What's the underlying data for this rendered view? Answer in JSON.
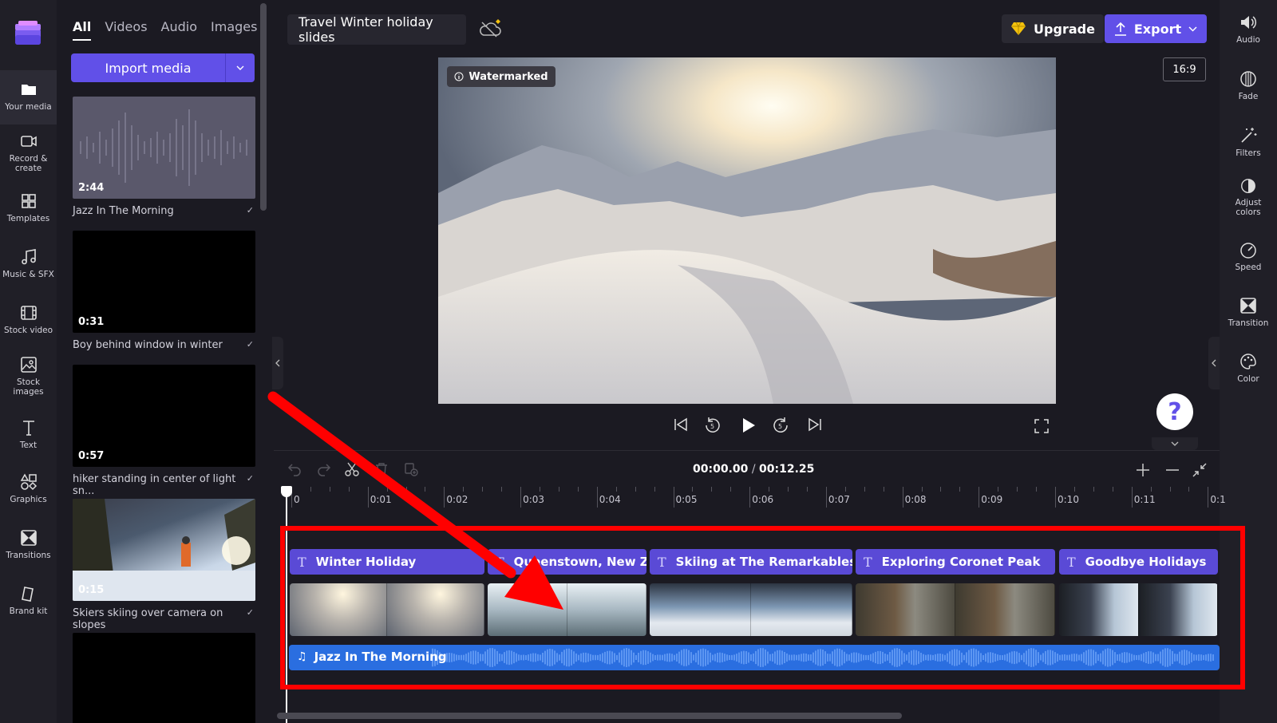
{
  "project_title": "Travel Winter holiday slides",
  "left_rail": {
    "items": [
      {
        "label": "Your media"
      },
      {
        "label": "Record & create"
      },
      {
        "label": "Templates"
      },
      {
        "label": "Music & SFX"
      },
      {
        "label": "Stock video"
      },
      {
        "label": "Stock images"
      },
      {
        "label": "Text"
      },
      {
        "label": "Graphics"
      },
      {
        "label": "Transitions"
      },
      {
        "label": "Brand kit"
      }
    ]
  },
  "media_panel": {
    "tabs": [
      "All",
      "Videos",
      "Audio",
      "Images"
    ],
    "import_label": "Import media",
    "items": [
      {
        "duration": "2:44",
        "title": "Jazz In The Morning"
      },
      {
        "duration": "0:31",
        "title": "Boy behind window in winter"
      },
      {
        "duration": "0:57",
        "title": "hiker standing in center of light sn..."
      },
      {
        "duration": "0:15",
        "title": "Skiers skiing over camera on slopes"
      }
    ]
  },
  "top_bar": {
    "upgrade_label": "Upgrade",
    "export_label": "Export",
    "aspect_ratio": "16:9"
  },
  "preview": {
    "watermark_label": "Watermarked"
  },
  "right_rail": {
    "items": [
      {
        "label": "Audio"
      },
      {
        "label": "Fade"
      },
      {
        "label": "Filters"
      },
      {
        "label": "Adjust colors"
      },
      {
        "label": "Speed"
      },
      {
        "label": "Transition"
      },
      {
        "label": "Color"
      }
    ]
  },
  "timeline": {
    "current_time": "00:00.00",
    "separator": "/",
    "total_time": "00:12.25",
    "ruler_labels": [
      "0",
      "0:01",
      "0:02",
      "0:03",
      "0:04",
      "0:05",
      "0:06",
      "0:07",
      "0:08",
      "0:09",
      "0:10",
      "0:11",
      "0:1"
    ],
    "text_clips": [
      {
        "label": "Winter Holiday"
      },
      {
        "label": "Queenstown, New Zeal"
      },
      {
        "label": "Skiing at The Remarkables"
      },
      {
        "label": "Exploring Coronet Peak"
      },
      {
        "label": "Goodbye Holidays"
      }
    ],
    "audio_clip": {
      "label": "Jazz In The Morning"
    }
  },
  "help_label": "?",
  "colors": {
    "accent": "#6150e8",
    "audio_track": "#2a6ee0",
    "annotation": "#ff0000"
  }
}
